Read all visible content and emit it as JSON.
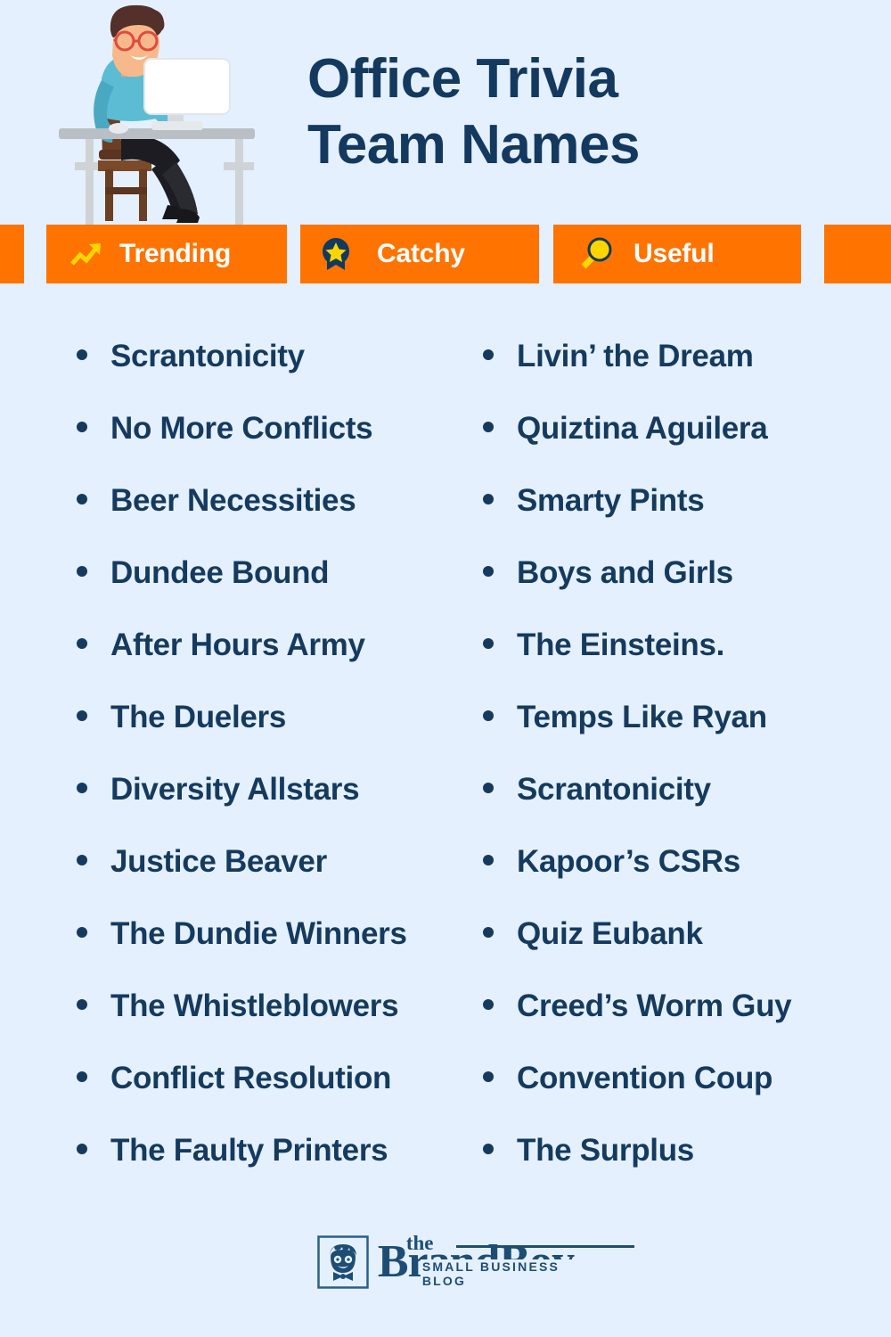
{
  "header": {
    "title_line1": "Office Trivia",
    "title_line2": "Team Names",
    "illustration_alt": "man-working-at-desk-illustration"
  },
  "badges": [
    {
      "label": "Trending",
      "icon": "trending-up-arrow-icon"
    },
    {
      "label": "Catchy",
      "icon": "award-ribbon-star-icon"
    },
    {
      "label": "Useful",
      "icon": "magnifying-glass-icon"
    }
  ],
  "colors": {
    "background": "#e4f0fd",
    "accent_orange": "#ff7300",
    "navy": "#153a5e",
    "yellow": "#ffd500",
    "white": "#ffffff",
    "logo_blue": "#1d4d74"
  },
  "list": {
    "left_column": [
      "Scrantonicity",
      "No More Conflicts",
      "Beer Necessities",
      "Dundee Bound",
      "After Hours Army",
      "The Duelers",
      "Diversity Allstars",
      "Justice Beaver",
      "The Dundie Winners",
      "The Whistleblowers",
      "Conflict Resolution",
      "The Faulty Printers"
    ],
    "right_column": [
      "Livin’ the Dream",
      "Quiztina Aguilera",
      "Smarty Pints",
      "Boys and Girls",
      "The Einsteins.",
      "Temps Like Ryan",
      "Scrantonicity",
      "Kapoor’s CSRs",
      "Quiz Eubank",
      "Creed’s Worm Guy",
      "Convention Coup",
      "The Surplus"
    ]
  },
  "footer": {
    "logo_the": "the",
    "logo_name": "BrandBoy",
    "logo_tagline": "SMALL BUSINESS BLOG",
    "logo_mark": "boy-face-logo-icon"
  }
}
